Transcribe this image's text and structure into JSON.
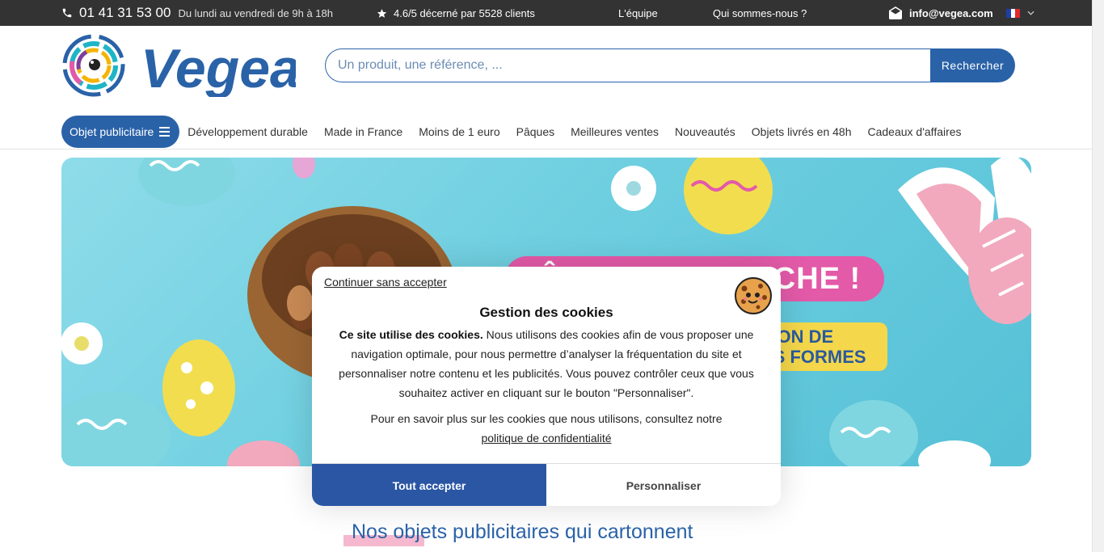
{
  "topbar": {
    "phone": "01 41 31 53 00",
    "hours": "Du lundi au vendredi de 9h à 18h",
    "rating": "4.6/5 décerné par 5528 clients",
    "team": "L'équipe",
    "about": "Qui sommes-nous ?",
    "email": "info@vegea.com",
    "flag_colors": [
      "#1f3ea6",
      "#ffffff",
      "#e1262d"
    ]
  },
  "header": {
    "brand": "Vegea",
    "search_placeholder": "Un produit, une référence, ...",
    "search_button": "Rechercher"
  },
  "nav": {
    "main": "Objet publicitaire",
    "items": [
      "Développement durable",
      "Made in France",
      "Moins de 1 euro",
      "Pâques",
      "Meilleures ventes",
      "Nouveautés",
      "Objets livrés en 48h",
      "Cadeaux d'affaires"
    ]
  },
  "banner": {
    "title": "PÂQUES APPROCHE !",
    "subtitle_line1": "TION DE",
    "subtitle_line2": "ES FORMES"
  },
  "section": {
    "title": "Nos objets publicitaires qui cartonnent"
  },
  "cookie": {
    "continue": "Continuer sans accepter",
    "title": "Gestion des cookies",
    "lead": "Ce site utilise des cookies.",
    "text": " Nous utilisons des cookies afin de vous proposer une navigation optimale, pour nous permettre d’analyser la fréquentation du site et personnaliser notre contenu et les publicités. Vous pouvez contrôler ceux que vous souhaitez activer en cliquant sur le bouton \"Personnaliser\".",
    "more": "Pour en savoir plus sur les cookies que nous utilisons, consultez notre",
    "policy_link": "politique de confidentialité",
    "accept": "Tout accepter",
    "customize": "Personnaliser"
  },
  "colors": {
    "primary": "#2a62a8",
    "topbar": "#333333",
    "accept": "#2a56a4"
  }
}
